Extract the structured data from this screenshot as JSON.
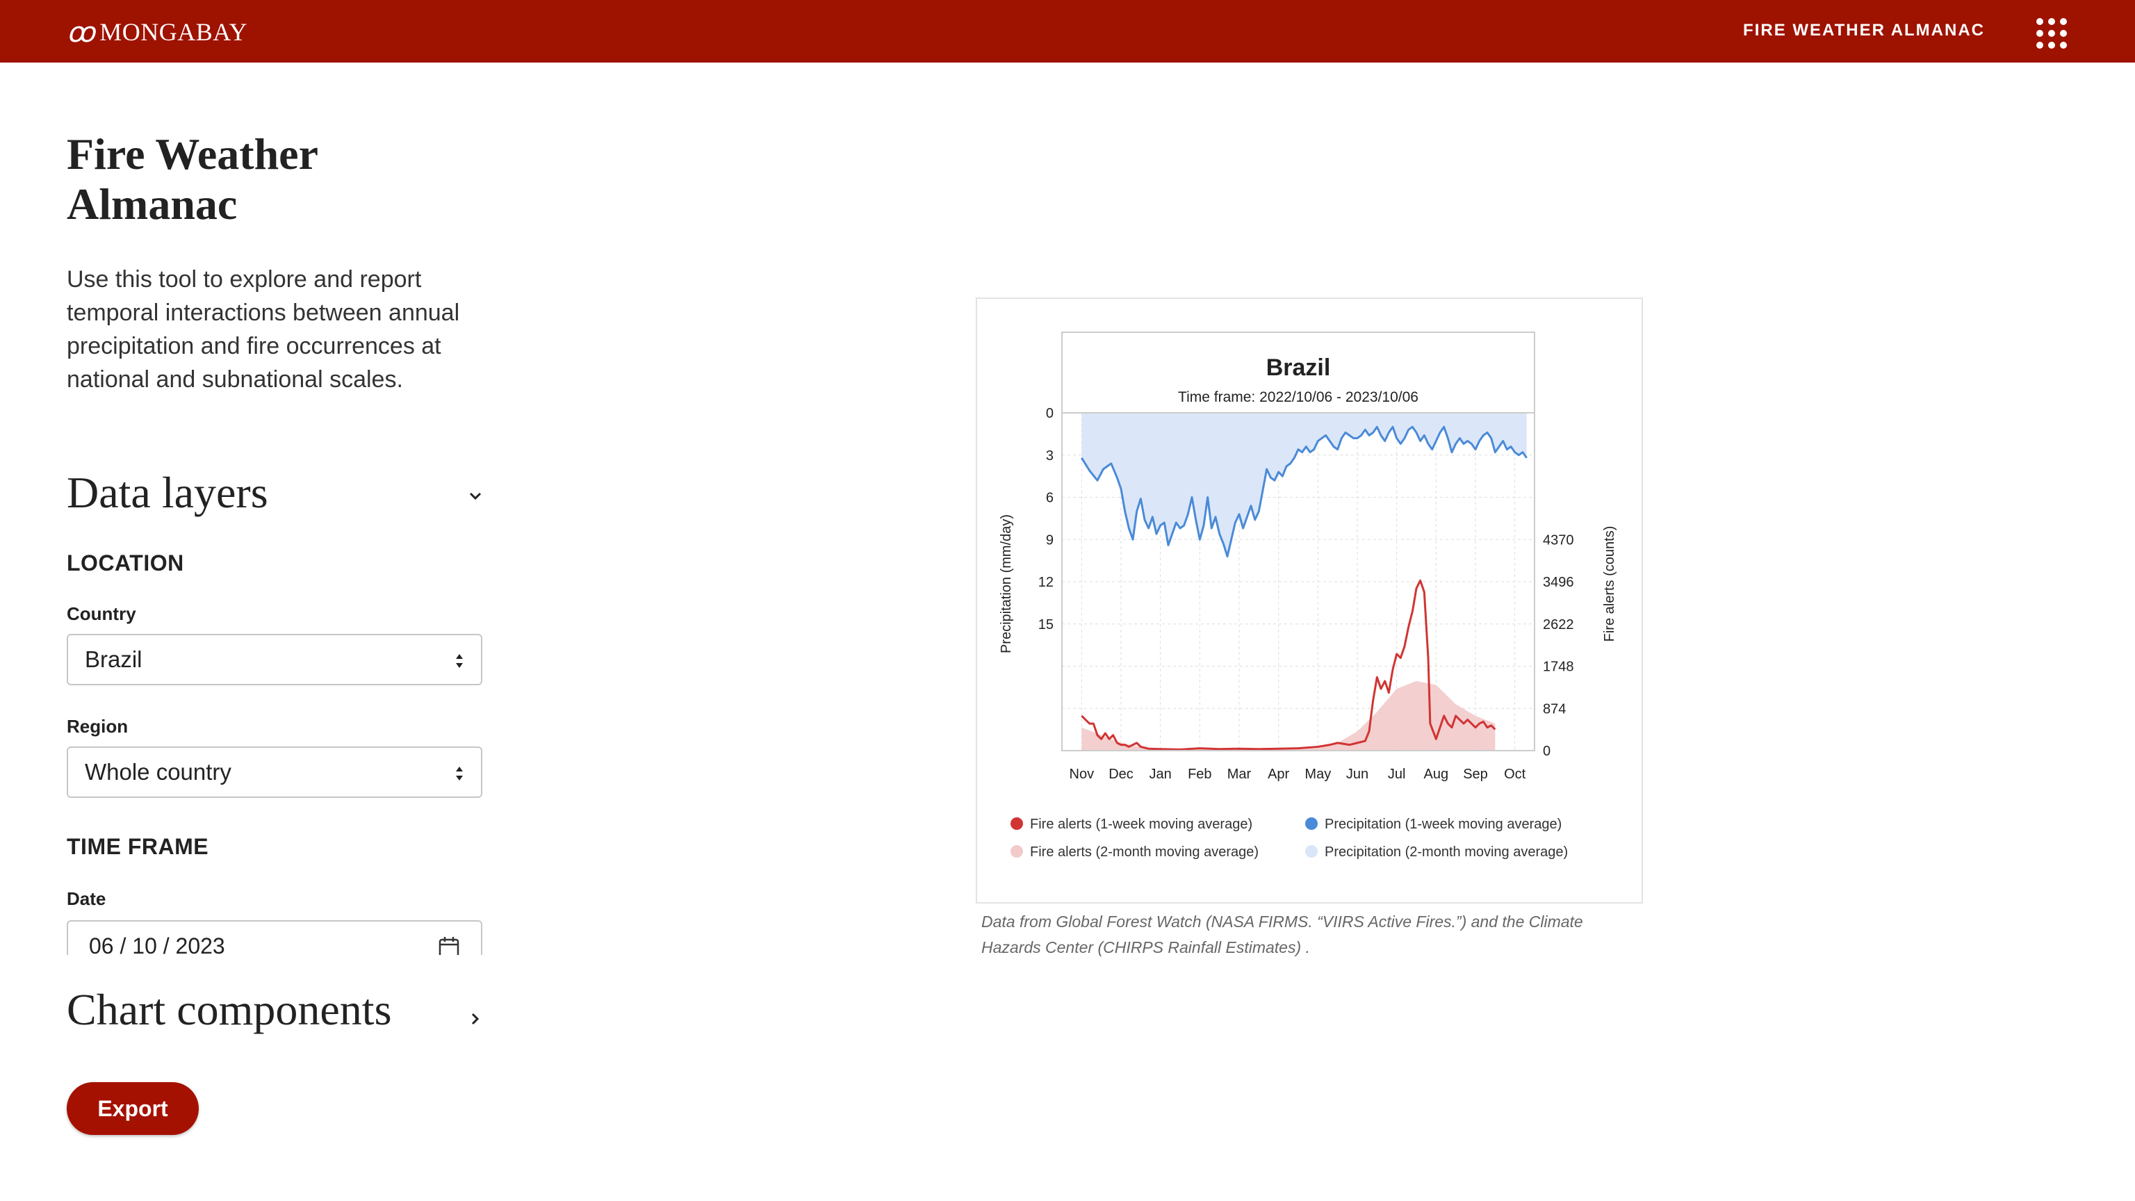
{
  "header": {
    "logo_text": "MONGABAY",
    "nav_title": "FIRE WEATHER ALMANAC",
    "menu_icon": "apps-grid-icon"
  },
  "sidebar": {
    "title": "Fire Weather Almanac",
    "intro": "Use this tool to explore and report temporal interactions between annual precipitation and fire occurrences at national and subnational scales.",
    "data_layers": {
      "heading": "Data layers",
      "location_label": "LOCATION",
      "country_label": "Country",
      "country_value": "Brazil",
      "region_label": "Region",
      "region_value": "Whole country",
      "time_frame_label": "TIME FRAME",
      "date_label": "Date",
      "date_value": "06 / 10 / 2023"
    },
    "chart_components": {
      "heading": "Chart components"
    },
    "export_label": "Export"
  },
  "caption": "Data from Global Forest Watch (NASA FIRMS. “VIIRS Active Fires.”) and the Climate Hazards Center (CHIRPS Rainfall Estimates) .",
  "chart_data": {
    "type": "line",
    "title": "Brazil",
    "subtitle": "Time frame: 2022/10/06 - 2023/10/06",
    "xlabel": "",
    "categories": [
      "Nov",
      "Dec",
      "Jan",
      "Feb",
      "Mar",
      "Apr",
      "May",
      "Jun",
      "Jul",
      "Aug",
      "Sep",
      "Oct"
    ],
    "y_left": {
      "label": "Precipitation (mm/day)",
      "ticks": [
        "0",
        "3",
        "6",
        "9",
        "12",
        "15"
      ],
      "range": [
        0,
        24
      ],
      "inverted": true
    },
    "y_right": {
      "label": "Fire alerts (counts)",
      "ticks": [
        "0",
        "874",
        "1748",
        "2622",
        "3496",
        "4370"
      ],
      "range": [
        0,
        8740
      ]
    },
    "colors": {
      "fire_week": "#d13434",
      "fire_2month": "#f2caca",
      "precip_week": "#4a8ad8",
      "precip_2month": "#d9e6f8"
    },
    "series": [
      {
        "name": "Precipitation (1-week moving average)",
        "axis": "left",
        "points": [
          [
            0.0,
            3.2
          ],
          [
            0.2,
            4.1
          ],
          [
            0.4,
            4.8
          ],
          [
            0.55,
            4.0
          ],
          [
            0.75,
            3.6
          ],
          [
            0.9,
            4.6
          ],
          [
            1.0,
            5.4
          ],
          [
            1.1,
            7.0
          ],
          [
            1.2,
            8.2
          ],
          [
            1.3,
            9.0
          ],
          [
            1.4,
            7.0
          ],
          [
            1.5,
            6.1
          ],
          [
            1.6,
            7.6
          ],
          [
            1.7,
            8.2
          ],
          [
            1.8,
            7.4
          ],
          [
            1.9,
            8.6
          ],
          [
            2.0,
            8.0
          ],
          [
            2.1,
            7.8
          ],
          [
            2.2,
            9.4
          ],
          [
            2.3,
            8.6
          ],
          [
            2.4,
            7.8
          ],
          [
            2.5,
            8.2
          ],
          [
            2.6,
            8.0
          ],
          [
            2.7,
            7.2
          ],
          [
            2.8,
            6.0
          ],
          [
            2.9,
            7.6
          ],
          [
            3.0,
            9.0
          ],
          [
            3.1,
            8.0
          ],
          [
            3.2,
            6.0
          ],
          [
            3.3,
            8.2
          ],
          [
            3.4,
            7.4
          ],
          [
            3.5,
            8.6
          ],
          [
            3.6,
            9.3
          ],
          [
            3.7,
            10.2
          ],
          [
            3.8,
            9.0
          ],
          [
            3.9,
            7.8
          ],
          [
            4.0,
            7.2
          ],
          [
            4.1,
            8.2
          ],
          [
            4.2,
            7.4
          ],
          [
            4.3,
            6.6
          ],
          [
            4.4,
            7.6
          ],
          [
            4.5,
            7.0
          ],
          [
            4.6,
            5.5
          ],
          [
            4.7,
            4.0
          ],
          [
            4.8,
            4.6
          ],
          [
            4.9,
            4.8
          ],
          [
            5.0,
            4.2
          ],
          [
            5.1,
            4.5
          ],
          [
            5.2,
            3.8
          ],
          [
            5.3,
            3.6
          ],
          [
            5.4,
            3.2
          ],
          [
            5.5,
            2.6
          ],
          [
            5.6,
            2.8
          ],
          [
            5.7,
            2.4
          ],
          [
            5.8,
            2.8
          ],
          [
            5.9,
            2.6
          ],
          [
            6.0,
            2.0
          ],
          [
            6.1,
            1.8
          ],
          [
            6.2,
            1.6
          ],
          [
            6.3,
            2.0
          ],
          [
            6.4,
            2.4
          ],
          [
            6.5,
            2.6
          ],
          [
            6.6,
            1.8
          ],
          [
            6.7,
            1.4
          ],
          [
            6.8,
            1.6
          ],
          [
            6.9,
            1.8
          ],
          [
            7.0,
            1.8
          ],
          [
            7.1,
            1.6
          ],
          [
            7.2,
            1.2
          ],
          [
            7.3,
            1.6
          ],
          [
            7.4,
            1.4
          ],
          [
            7.5,
            1.0
          ],
          [
            7.6,
            1.6
          ],
          [
            7.7,
            2.0
          ],
          [
            7.8,
            1.4
          ],
          [
            7.9,
            1.0
          ],
          [
            8.0,
            1.8
          ],
          [
            8.1,
            2.2
          ],
          [
            8.2,
            1.8
          ],
          [
            8.3,
            1.2
          ],
          [
            8.4,
            1.0
          ],
          [
            8.5,
            1.4
          ],
          [
            8.6,
            2.0
          ],
          [
            8.7,
            1.6
          ],
          [
            8.8,
            2.2
          ],
          [
            8.9,
            2.6
          ],
          [
            9.0,
            2.0
          ],
          [
            9.1,
            1.4
          ],
          [
            9.2,
            1.0
          ],
          [
            9.3,
            1.8
          ],
          [
            9.4,
            2.8
          ],
          [
            9.5,
            2.2
          ],
          [
            9.6,
            1.8
          ],
          [
            9.7,
            2.2
          ],
          [
            9.8,
            2.0
          ],
          [
            9.9,
            2.2
          ],
          [
            10.0,
            2.6
          ],
          [
            10.1,
            2.0
          ],
          [
            10.2,
            1.6
          ],
          [
            10.3,
            1.4
          ],
          [
            10.4,
            1.8
          ],
          [
            10.5,
            2.8
          ],
          [
            10.6,
            2.4
          ],
          [
            10.7,
            2.0
          ],
          [
            10.8,
            2.6
          ],
          [
            10.9,
            2.4
          ],
          [
            11.0,
            2.8
          ],
          [
            11.1,
            3.0
          ],
          [
            11.2,
            2.8
          ],
          [
            11.3,
            3.2
          ]
        ]
      },
      {
        "name": "Precipitation (2-month moving average)",
        "axis": "left",
        "fill": "area",
        "points": [
          [
            0.0,
            4.0
          ],
          [
            1.0,
            5.5
          ],
          [
            2.0,
            7.0
          ],
          [
            3.0,
            7.8
          ],
          [
            4.0,
            7.6
          ],
          [
            5.0,
            5.5
          ],
          [
            6.0,
            3.0
          ],
          [
            7.0,
            2.2
          ],
          [
            8.0,
            1.8
          ],
          [
            9.0,
            2.0
          ],
          [
            10.0,
            2.2
          ],
          [
            11.3,
            2.8
          ]
        ]
      },
      {
        "name": "Fire alerts (1-week moving average)",
        "axis": "right",
        "points": [
          [
            0.0,
            900
          ],
          [
            0.1,
            800
          ],
          [
            0.2,
            700
          ],
          [
            0.3,
            700
          ],
          [
            0.4,
            400
          ],
          [
            0.5,
            300
          ],
          [
            0.6,
            450
          ],
          [
            0.7,
            300
          ],
          [
            0.8,
            400
          ],
          [
            0.9,
            200
          ],
          [
            1.0,
            150
          ],
          [
            1.1,
            150
          ],
          [
            1.2,
            100
          ],
          [
            1.4,
            200
          ],
          [
            1.5,
            100
          ],
          [
            1.7,
            50
          ],
          [
            2.0,
            40
          ],
          [
            2.5,
            30
          ],
          [
            3.0,
            60
          ],
          [
            3.5,
            40
          ],
          [
            4.0,
            50
          ],
          [
            4.5,
            40
          ],
          [
            5.0,
            50
          ],
          [
            5.5,
            60
          ],
          [
            6.0,
            100
          ],
          [
            6.3,
            150
          ],
          [
            6.5,
            200
          ],
          [
            6.8,
            150
          ],
          [
            7.0,
            200
          ],
          [
            7.2,
            250
          ],
          [
            7.3,
            500
          ],
          [
            7.4,
            1300
          ],
          [
            7.5,
            1900
          ],
          [
            7.6,
            1600
          ],
          [
            7.7,
            1800
          ],
          [
            7.8,
            1500
          ],
          [
            7.9,
            2100
          ],
          [
            8.0,
            2500
          ],
          [
            8.1,
            2400
          ],
          [
            8.2,
            2700
          ],
          [
            8.3,
            3200
          ],
          [
            8.4,
            3600
          ],
          [
            8.5,
            4200
          ],
          [
            8.6,
            4400
          ],
          [
            8.7,
            4100
          ],
          [
            8.8,
            2400
          ],
          [
            8.85,
            700
          ],
          [
            9.0,
            300
          ],
          [
            9.1,
            600
          ],
          [
            9.2,
            900
          ],
          [
            9.3,
            700
          ],
          [
            9.4,
            600
          ],
          [
            9.5,
            900
          ],
          [
            9.6,
            800
          ],
          [
            9.7,
            700
          ],
          [
            9.8,
            800
          ],
          [
            9.9,
            700
          ],
          [
            10.0,
            600
          ],
          [
            10.1,
            700
          ],
          [
            10.2,
            750
          ],
          [
            10.3,
            600
          ],
          [
            10.4,
            650
          ],
          [
            10.5,
            550
          ]
        ]
      },
      {
        "name": "Fire alerts (2-month moving average)",
        "axis": "right",
        "fill": "area",
        "points": [
          [
            0.0,
            600
          ],
          [
            0.5,
            400
          ],
          [
            1.0,
            200
          ],
          [
            1.5,
            100
          ],
          [
            2.0,
            50
          ],
          [
            3.0,
            40
          ],
          [
            4.0,
            40
          ],
          [
            5.0,
            50
          ],
          [
            6.0,
            80
          ],
          [
            6.5,
            200
          ],
          [
            7.0,
            500
          ],
          [
            7.5,
            1000
          ],
          [
            8.0,
            1600
          ],
          [
            8.5,
            1800
          ],
          [
            9.0,
            1700
          ],
          [
            9.5,
            1200
          ],
          [
            10.0,
            900
          ],
          [
            10.5,
            700
          ]
        ]
      }
    ],
    "legend": {
      "placement": "bottom",
      "items": [
        "Fire alerts (1-week moving average)",
        "Precipitation (1-week moving average)",
        "Fire alerts (2-month moving average)",
        "Precipitation (2-month moving average)"
      ]
    },
    "grid": true
  }
}
